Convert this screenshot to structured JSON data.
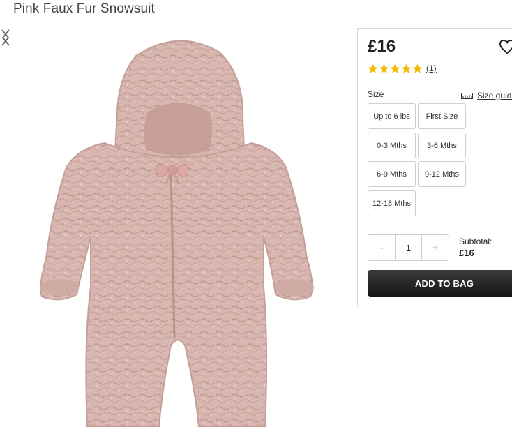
{
  "product": {
    "title": "Pink Faux Fur Snowsuit",
    "image_alt": "pink faux fur snowsuit with hood and bow",
    "colors": {
      "fur": "#d6b3ac",
      "fur_shadow": "#b8918a",
      "bow": "#dca8a4"
    }
  },
  "gallery": {
    "prev_icon": "chevron-left-icon",
    "next_icon": "chevron-right-icon"
  },
  "buy_box": {
    "price": "£16",
    "wishlist_icon": "heart-icon",
    "rating": {
      "stars": 5,
      "max": 5,
      "color": "#f5b800",
      "count_label": "(1)"
    },
    "size": {
      "label": "Size",
      "guide_label": "Size guide",
      "guide_icon": "ruler-icon",
      "options": [
        "Up to 6 lbs",
        "First Size",
        "0-3 Mths",
        "3-6 Mths",
        "6-9 Mths",
        "9-12 Mths",
        "12-18 Mths"
      ]
    },
    "quantity": {
      "minus": "-",
      "value": "1",
      "plus": "+"
    },
    "subtotal": {
      "label": "Subtotal:",
      "value": "£16"
    },
    "add_to_bag": "ADD TO BAG"
  }
}
